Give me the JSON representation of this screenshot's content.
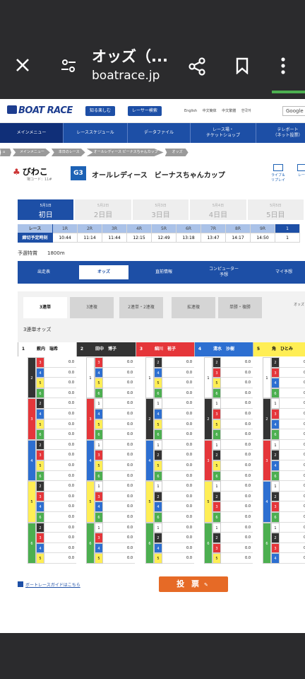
{
  "browser": {
    "title": "オッズ（...",
    "url": "boatrace.jp"
  },
  "header": {
    "logo": "BOAT RACE",
    "pill1": "知る楽しむ",
    "pill2": "レーサー検索",
    "langs": "English 中文簡体 中文繁體 한국어",
    "search": "Google"
  },
  "nav": [
    {
      "label": "メインメニュー",
      "active": true
    },
    {
      "label": "レーススケジュール"
    },
    {
      "label": "データファイル"
    },
    {
      "label": "レース場・\nチケットショップ"
    },
    {
      "label": "テレボート\n（ネット投票）"
    }
  ],
  "breadcrumb": [
    "メインメニュー",
    "本日のレース",
    "オールレディース ビーナスちゃんカップ",
    "オッズ"
  ],
  "race": {
    "venue": "びわこ",
    "code": "場コード：11#",
    "grade": "G3",
    "title": "オールレディース　ビーナスちゃんカップ",
    "live": "ライブ＆\nリプレイ",
    "live2": "レー\n　"
  },
  "days": [
    {
      "date": "5月1日",
      "day": "初日",
      "on": true
    },
    {
      "date": "5月2日",
      "day": "2日目"
    },
    {
      "date": "5月3日",
      "day": "3日目"
    },
    {
      "date": "5月4日",
      "day": "4日目"
    },
    {
      "date": "5月5日",
      "day": "5日目"
    }
  ],
  "races": {
    "label": "レース",
    "races": [
      "1R",
      "2R",
      "3R",
      "4R",
      "5R",
      "6R",
      "7R",
      "8R",
      "9R",
      "1"
    ],
    "time_label": "締切予定時刻",
    "times": [
      "10:44",
      "11:14",
      "11:44",
      "12:15",
      "12:49",
      "13:18",
      "13:47",
      "14:17",
      "14:50",
      "1"
    ]
  },
  "yosen": {
    "name": "予選特賞",
    "distance": "1800m"
  },
  "tabs": [
    "出走表",
    "オッズ",
    "直前情報",
    "コンピューター\n予想",
    "マイ予想"
  ],
  "subtabs": [
    "3連単",
    "3連複",
    "2連単・2連複",
    "拡連複",
    "単勝・複勝"
  ],
  "odds_label": "3連単オッズ",
  "odds_hint": "オッズ",
  "racers": [
    {
      "no": "1",
      "name": "薮内　瑞希"
    },
    {
      "no": "2",
      "name": "田中　博子"
    },
    {
      "no": "3",
      "name": "細川　裕子"
    },
    {
      "no": "4",
      "name": "清水　沙樹"
    },
    {
      "no": "5",
      "name": "角　ひとみ"
    }
  ],
  "odds_value": "0.0",
  "colors": {
    "1": "#ffffff",
    "2": "#333333",
    "3": "#e5363a",
    "4": "#2d6fd1",
    "5": "#ffee55",
    "6": "#4caf50"
  },
  "footer": {
    "guide": "ボートレースガイドはこちら",
    "buy": "投 票"
  }
}
